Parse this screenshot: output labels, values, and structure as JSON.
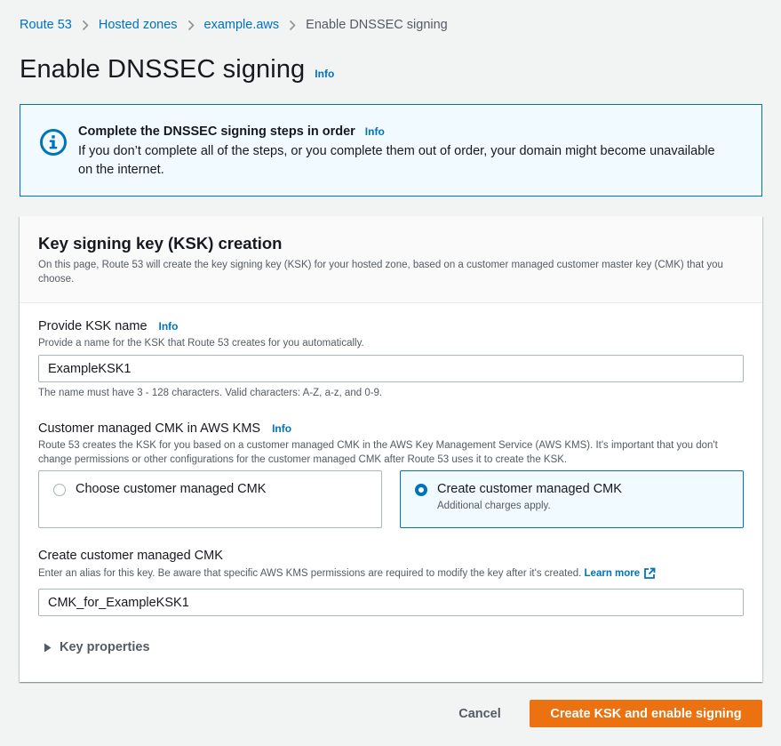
{
  "breadcrumb": {
    "items": [
      "Route 53",
      "Hosted zones",
      "example.aws"
    ],
    "current": "Enable DNSSEC signing"
  },
  "page": {
    "title": "Enable DNSSEC signing",
    "info_label": "Info"
  },
  "alert": {
    "title": "Complete the DNSSEC signing steps in order",
    "info_label": "Info",
    "body": "If you don’t complete all of the steps, or you complete them out of order, your domain might become unavailable on the internet.",
    "icon": "info-circle-icon",
    "color": "#0073bb"
  },
  "ksk_section": {
    "title": "Key signing key (KSK) creation",
    "description": "On this page, Route 53 will create the key signing key (KSK) for your hosted zone, based on a customer managed customer master key (CMK) that you choose.",
    "ksk_name": {
      "label": "Provide KSK name",
      "info_label": "Info",
      "description": "Provide a name for the KSK that Route 53 creates for you automatically.",
      "value": "ExampleKSK1",
      "constraint": "The name must have 3 - 128 characters. Valid characters: A-Z, a-z, and 0-9."
    },
    "cmk": {
      "label": "Customer managed CMK in AWS KMS",
      "info_label": "Info",
      "description": "Route 53 creates the KSK for you based on a customer managed CMK in the AWS Key Management Service (AWS KMS). It's important that you don't change permissions or other configurations for the customer managed CMK after Route 53 uses it to create the KSK.",
      "options": [
        {
          "label": "Choose customer managed CMK",
          "sublabel": "",
          "selected": false
        },
        {
          "label": "Create customer managed CMK",
          "sublabel": "Additional charges apply.",
          "selected": true
        }
      ]
    },
    "create_cmk": {
      "label": "Create customer managed CMK",
      "description": "Enter an alias for this key. Be aware that specific AWS KMS permissions are required to modify the key after it's created.",
      "learn_more": "Learn more",
      "value": "CMK_for_ExampleKSK1"
    },
    "key_properties": {
      "label": "Key properties",
      "expanded": false
    }
  },
  "actions": {
    "cancel": "Cancel",
    "submit": "Create KSK and enable signing",
    "primary_color": "#ec7211"
  }
}
